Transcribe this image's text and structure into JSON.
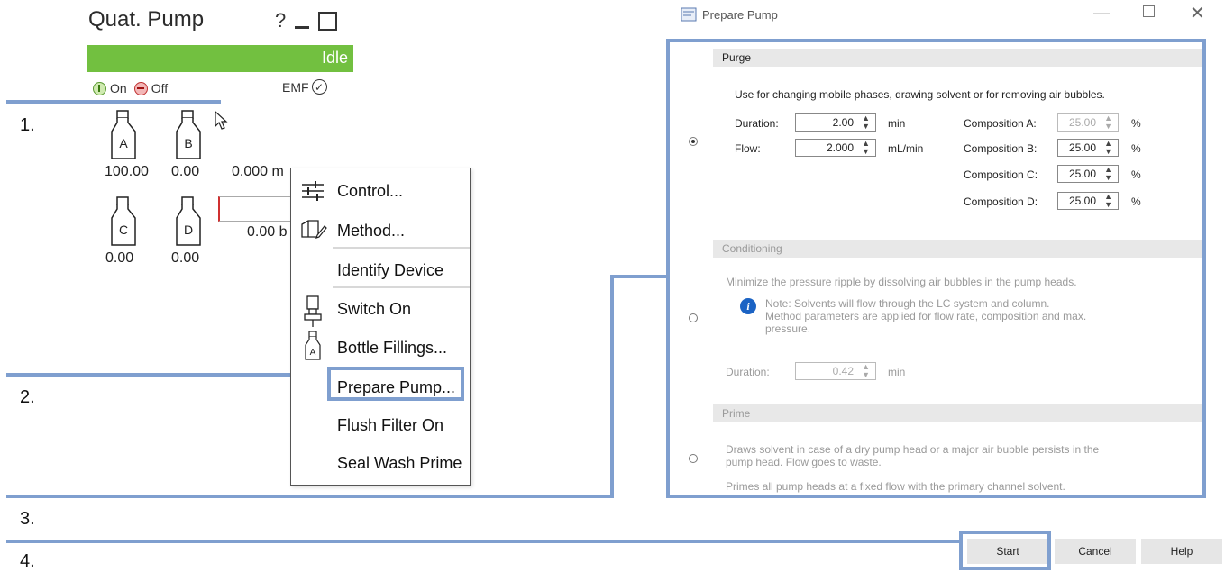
{
  "pump": {
    "title": "Quat. Pump",
    "help_glyph": "?",
    "status": "Idle",
    "status_color": "#72c040",
    "on_label": "On",
    "off_label": "Off",
    "emf_label": "EMF",
    "bottles": [
      {
        "letter": "A",
        "value": "100.00"
      },
      {
        "letter": "B",
        "value": "0.00"
      },
      {
        "letter": "C",
        "value": "0.00"
      },
      {
        "letter": "D",
        "value": "0.00"
      }
    ],
    "flow_text": "0.000 m",
    "pressure_text": "0.00 b"
  },
  "steps": [
    "1.",
    "2.",
    "3.",
    "4."
  ],
  "context_menu": {
    "items": [
      {
        "label": "Control...",
        "icon": "sliders-icon"
      },
      {
        "label": "Method...",
        "icon": "method-icon"
      },
      {
        "label": "Identify Device",
        "icon": ""
      },
      {
        "label": "Switch On",
        "icon": "pump-icon"
      },
      {
        "label": "Bottle Fillings...",
        "icon": "bottle-icon"
      },
      {
        "label": "Prepare Pump...",
        "icon": ""
      },
      {
        "label": "Flush Filter On",
        "icon": ""
      },
      {
        "label": "Seal Wash Prime",
        "icon": ""
      }
    ]
  },
  "dialog": {
    "title": "Prepare Pump",
    "purge": {
      "header": "Purge",
      "description": "Use for changing mobile phases, drawing solvent or for removing air bubbles.",
      "duration_label": "Duration:",
      "duration_value": "2.00",
      "duration_unit": "min",
      "flow_label": "Flow:",
      "flow_value": "2.000",
      "flow_unit": "mL/min",
      "compositions": [
        {
          "label": "Composition A:",
          "value": "25.00",
          "unit": "%"
        },
        {
          "label": "Composition B:",
          "value": "25.00",
          "unit": "%"
        },
        {
          "label": "Composition C:",
          "value": "25.00",
          "unit": "%"
        },
        {
          "label": "Composition D:",
          "value": "25.00",
          "unit": "%"
        }
      ]
    },
    "conditioning": {
      "header": "Conditioning",
      "description": "Minimize the pressure ripple by dissolving air bubbles in the pump heads.",
      "note_line1": "Note: Solvents will flow through the LC system and column.",
      "note_line2": "Method parameters are applied for flow rate, composition and max.",
      "note_line3": "pressure.",
      "duration_label": "Duration:",
      "duration_value": "0.42",
      "duration_unit": "min"
    },
    "prime": {
      "header": "Prime",
      "description_line1": "Draws solvent in case of a dry pump head or a major air bubble persists in the",
      "description_line2": "pump head. Flow goes to waste.",
      "description_line3": "Primes all pump heads at a fixed flow with the primary channel solvent."
    },
    "buttons": {
      "start": "Start",
      "cancel": "Cancel",
      "help": "Help"
    }
  },
  "colors": {
    "highlight": "#7f9fcf",
    "info": "#1b63c4"
  }
}
